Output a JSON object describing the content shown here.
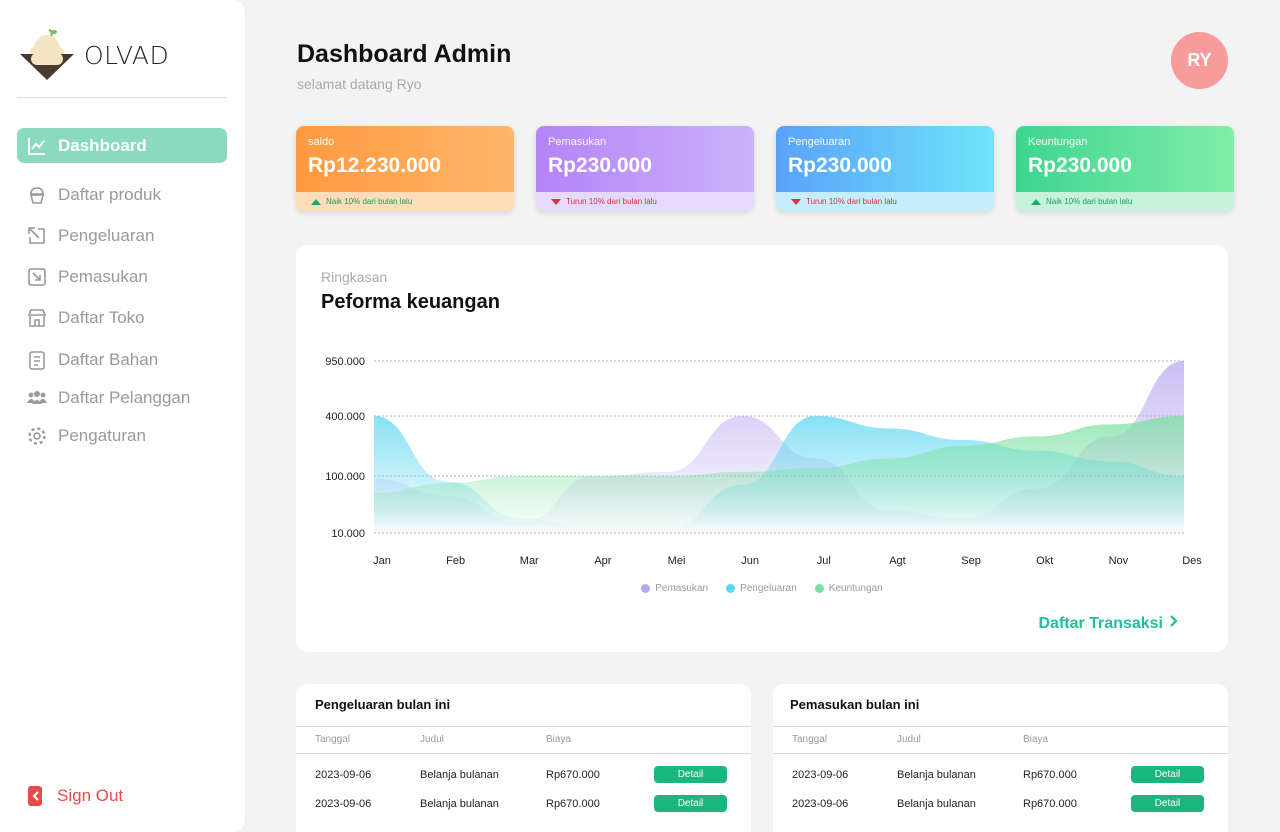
{
  "brand": {
    "name": "OLVAD"
  },
  "sidebar": {
    "items": [
      {
        "label": "Dashboard",
        "icon": "chart-line-icon",
        "active": true
      },
      {
        "label": "Daftar produk",
        "icon": "cupcake-icon"
      },
      {
        "label": "Pengeluaran",
        "icon": "arrow-out-icon"
      },
      {
        "label": "Pemasukan",
        "icon": "arrow-in-icon"
      },
      {
        "label": "Daftar Toko",
        "icon": "store-icon"
      },
      {
        "label": "Daftar Bahan",
        "icon": "document-icon"
      },
      {
        "label": "Daftar Pelanggan",
        "icon": "users-icon"
      },
      {
        "label": "Pengaturan",
        "icon": "gear-icon"
      }
    ],
    "signout": "Sign Out"
  },
  "header": {
    "title": "Dashboard Admin",
    "subtitle": "selamat datang Ryo",
    "avatar_initials": "RY"
  },
  "stats": [
    {
      "label": "saldo",
      "value": "Rp12.230.000",
      "trend": "up",
      "note": "Naik 10% dari bulan lalu",
      "color": "#ff9a3c"
    },
    {
      "label": "Pemasukan",
      "value": "Rp230.000",
      "trend": "down",
      "note": "Turun 10% dari bulan lalu",
      "color": "#b98af8"
    },
    {
      "label": "Pengeluaran",
      "value": "Rp230.000",
      "trend": "down",
      "note": "Turun 10% dari bulan lalu",
      "color": "#5aa8f8"
    },
    {
      "label": "Keuntungan",
      "value": "Rp230.000",
      "trend": "up",
      "note": "Naik 10% dari bulan lalu",
      "color": "#3fd891"
    }
  ],
  "chart_section": {
    "subtitle": "Ringkasan",
    "title": "Peforma keuangan",
    "link": "Daftar Transaksi"
  },
  "chart_data": {
    "type": "area",
    "y_scale": "log",
    "y_ticks": [
      10000,
      100000,
      400000,
      950000
    ],
    "y_tick_labels": [
      "10.000",
      "100.000",
      "400.000",
      "950.000"
    ],
    "categories": [
      "Jan",
      "Feb",
      "Mar",
      "Apr",
      "Mei",
      "Jun",
      "Jul",
      "Agt",
      "Sep",
      "Okt",
      "Nov",
      "Des"
    ],
    "series": [
      {
        "name": "Pemasukan",
        "color": "#b9a8f0",
        "values": [
          90000,
          45000,
          15000,
          100000,
          110000,
          400000,
          150000,
          25000,
          18000,
          60000,
          250000,
          950000
        ]
      },
      {
        "name": "Pengeluaran",
        "color": "#5fd6f2",
        "values": [
          400000,
          80000,
          18000,
          12000,
          12000,
          70000,
          400000,
          300000,
          230000,
          180000,
          140000,
          100000
        ]
      },
      {
        "name": "Keuntungan",
        "color": "#79e0a0",
        "values": [
          50000,
          75000,
          100000,
          100000,
          100000,
          110000,
          120000,
          150000,
          200000,
          250000,
          330000,
          400000
        ]
      }
    ],
    "legend": "bottom-center",
    "grid": true
  },
  "tables": [
    {
      "title": "Pengeluaran bulan ini",
      "columns": [
        "Tanggal",
        "Judul",
        "Biaya"
      ],
      "rows": [
        {
          "tanggal": "2023-09-06",
          "judul": "Belanja bulanan",
          "biaya": "Rp670.000",
          "action": "Detail"
        },
        {
          "tanggal": "2023-09-06",
          "judul": "Belanja bulanan",
          "biaya": "Rp670.000",
          "action": "Detail"
        }
      ]
    },
    {
      "title": "Pemasukan bulan ini",
      "columns": [
        "Tanggal",
        "Judul",
        "Biaya"
      ],
      "rows": [
        {
          "tanggal": "2023-09-06",
          "judul": "Belanja bulanan",
          "biaya": "Rp670.000",
          "action": "Detail"
        },
        {
          "tanggal": "2023-09-06",
          "judul": "Belanja bulanan",
          "biaya": "Rp670.000",
          "action": "Detail"
        }
      ]
    }
  ]
}
